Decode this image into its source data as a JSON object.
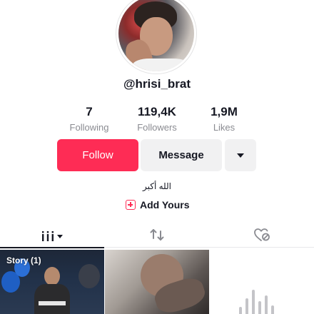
{
  "profile": {
    "username": "@hrisi_brat",
    "bio": "الله أكبر",
    "add_yours_label": "Add Yours"
  },
  "stats": {
    "following": {
      "value": "7",
      "label": "Following"
    },
    "followers": {
      "value": "119,4K",
      "label": "Followers"
    },
    "likes": {
      "value": "1,9M",
      "label": "Likes"
    }
  },
  "actions": {
    "follow_label": "Follow",
    "message_label": "Message"
  },
  "tabs": [
    {
      "icon": "grid-icon",
      "selected": true
    },
    {
      "icon": "repost-icon",
      "selected": false
    },
    {
      "icon": "liked-hidden-icon",
      "selected": false
    }
  ],
  "grid": {
    "items": [
      {
        "label": "Story (1)"
      },
      {
        "label": ""
      },
      {
        "label": ""
      }
    ]
  },
  "colors": {
    "accent": "#fe2c55",
    "text": "#161823",
    "muted": "#8a8b91",
    "button_bg": "#f1f1f2"
  }
}
